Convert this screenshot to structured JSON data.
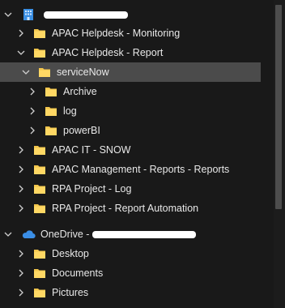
{
  "tree": {
    "group1": {
      "icon": "building-icon"
    },
    "items": [
      {
        "label": "APAC Helpdesk - Monitoring"
      },
      {
        "label": "APAC Helpdesk - Report"
      },
      {
        "label": "serviceNow"
      },
      {
        "label": "Archive"
      },
      {
        "label": "log"
      },
      {
        "label": "powerBI"
      },
      {
        "label": "APAC IT - SNOW"
      },
      {
        "label": "APAC Management - Reports - Reports"
      },
      {
        "label": "RPA Project - Log"
      },
      {
        "label": "RPA Project - Report Automation"
      }
    ],
    "onedrive": {
      "label": "OneDrive -",
      "icon": "cloud-icon"
    },
    "onedrive_items": [
      {
        "label": "Desktop"
      },
      {
        "label": "Documents"
      },
      {
        "label": "Pictures"
      }
    ]
  },
  "colors": {
    "background": "#191919",
    "selected_row": "#4b4b4b",
    "folder": "#f3c64c",
    "text": "#e8e8e8",
    "onedrive_cloud": "#3a8ee6"
  }
}
